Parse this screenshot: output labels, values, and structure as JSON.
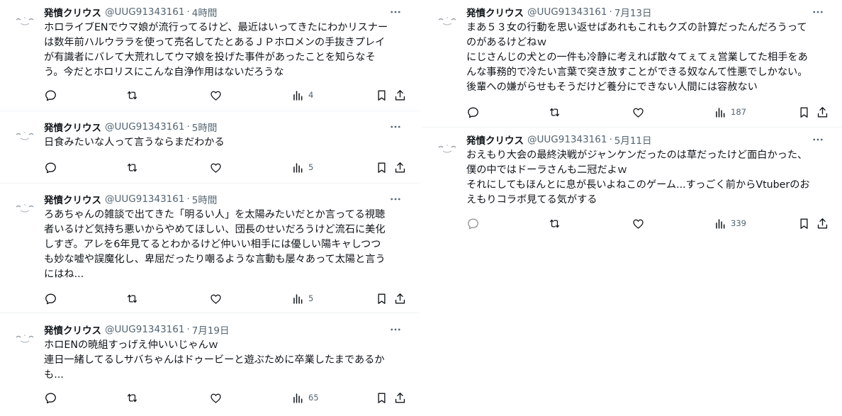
{
  "left_column": {
    "tweets": [
      {
        "author": "発憤クリウス",
        "handle": "@UUG91343161",
        "time": "4時間",
        "lines": [
          "ホロライブENでウマ娘が流行ってるけど、最近はいってきたにわかリスナー",
          "は数年前ハルウララを使って売名してたとあるＪＰホロメンの手抜きプレイ",
          "が有識者にバレて大荒れしてウマ娘を投げた事件があったことを知らなそ",
          "う。今だとホロリスにこんな自浄作用はないだろうな"
        ],
        "views": "4"
      },
      {
        "author": "発憤クリウス",
        "handle": "@UUG91343161",
        "time": "5時間",
        "lines": [
          "日食みたいな人って言うならまだわかる"
        ],
        "views": "5"
      },
      {
        "author": "発憤クリウス",
        "handle": "@UUG91343161",
        "time": "5時間",
        "lines": [
          "ろあちゃんの雑談で出てきた「明るい人」を太陽みたいだとか言ってる視聴",
          "者いるけど気持ち悪いからやめてほしい、団長のせいだろうけど流石に美化",
          "しすぎ。アレを6年見てるとわかるけど仲いい相手には優しい陽キャしつつ",
          "も妙な嘘や誤魔化し、卑屈だったり嘲るような言動も屡々あって太陽と言う",
          "にはね..."
        ],
        "views": "5"
      },
      {
        "author": "発憤クリウス",
        "handle": "@UUG91343161",
        "time": "7月19日",
        "lines": [
          "ホロENの暁組すっげえ仲いいじゃんｗ",
          "連日一緒してるしサバちゃんはドゥービーと遊ぶために卒業したまであるか",
          "も..."
        ],
        "views": "65"
      }
    ]
  },
  "right_column": {
    "tweets": [
      {
        "author": "発憤クリウス",
        "handle": "@UUG91343161",
        "time": "7月13日",
        "lines": [
          "まあ５３女の行動を思い返せばあれもこれもクズの計算だったんだろうって",
          "のがあるけどねｗ",
          "にじさんじの犬との一件も冷静に考えれば散々てぇてぇ営業してた相手をあ",
          "んな事務的で冷たい言葉で突き放すことができる奴なんて性悪でしかない。",
          "後輩への嫌がらせもそうだけど養分にできない人間には容赦ない"
        ],
        "views": "187"
      },
      {
        "author": "発憤クリウス",
        "handle": "@UUG91343161",
        "time": "5月11日",
        "lines": [
          "おえもり大会の最終決戦がジャンケンだったのは草だったけど面白かった、",
          "僕の中ではドーラさんも二冠だよｗ",
          "それにしてもほんとに息が長いよねこのゲーム...すっごく前からVtuberのお",
          "えもりコラボ見てる気がする"
        ],
        "views": "339"
      }
    ]
  },
  "icons": {
    "reply": "reply-icon",
    "retweet": "retweet-icon",
    "like": "heart-icon",
    "views": "views-icon",
    "bookmark": "bookmark-icon",
    "share": "share-icon",
    "more": "more-icon"
  },
  "colors": {
    "text": "#0f1419",
    "secondary": "#536471",
    "divider": "#eff3f4"
  }
}
